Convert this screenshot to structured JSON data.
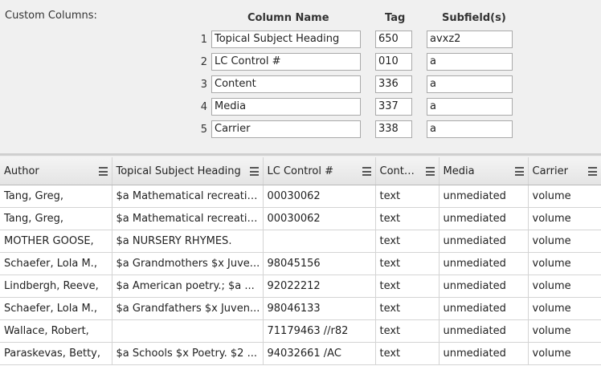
{
  "config": {
    "title": "Custom Columns:",
    "headers": {
      "name": "Column Name",
      "tag": "Tag",
      "subfields": "Subfield(s)"
    },
    "rows": [
      {
        "num": "1",
        "name": "Topical Subject Heading",
        "tag": "650",
        "subfields": "avxz2"
      },
      {
        "num": "2",
        "name": "LC Control #",
        "tag": "010",
        "subfields": "a"
      },
      {
        "num": "3",
        "name": "Content",
        "tag": "336",
        "subfields": "a"
      },
      {
        "num": "4",
        "name": "Media",
        "tag": "337",
        "subfields": "a"
      },
      {
        "num": "5",
        "name": "Carrier",
        "tag": "338",
        "subfields": "a"
      }
    ]
  },
  "grid": {
    "columns": [
      "Author",
      "Topical Subject Heading",
      "LC Control #",
      "Content",
      "Media",
      "Carrier"
    ],
    "rows": [
      [
        "Tang, Greg,",
        "$a Mathematical recreatio...",
        "00030062",
        "text",
        "unmediated",
        "volume"
      ],
      [
        "Tang, Greg,",
        "$a Mathematical recreatio...",
        "00030062",
        "text",
        "unmediated",
        "volume"
      ],
      [
        "MOTHER GOOSE,",
        "$a NURSERY RHYMES.",
        "",
        "text",
        "unmediated",
        "volume"
      ],
      [
        "Schaefer, Lola M.,",
        "$a Grandmothers $x Juve...",
        "98045156",
        "text",
        "unmediated",
        "volume"
      ],
      [
        "Lindbergh, Reeve,",
        "$a American poetry.; $a ...",
        "92022212",
        "text",
        "unmediated",
        "volume"
      ],
      [
        "Schaefer, Lola M.,",
        "$a Grandfathers $x Juven...",
        "98046133",
        "text",
        "unmediated",
        "volume"
      ],
      [
        "Wallace, Robert,",
        "",
        "71179463 //r82",
        "text",
        "unmediated",
        "volume"
      ],
      [
        "Paraskevas, Betty,",
        "$a Schools $x Poetry. $2 ...",
        "94032661 /AC",
        "text",
        "unmediated",
        "volume"
      ]
    ]
  }
}
